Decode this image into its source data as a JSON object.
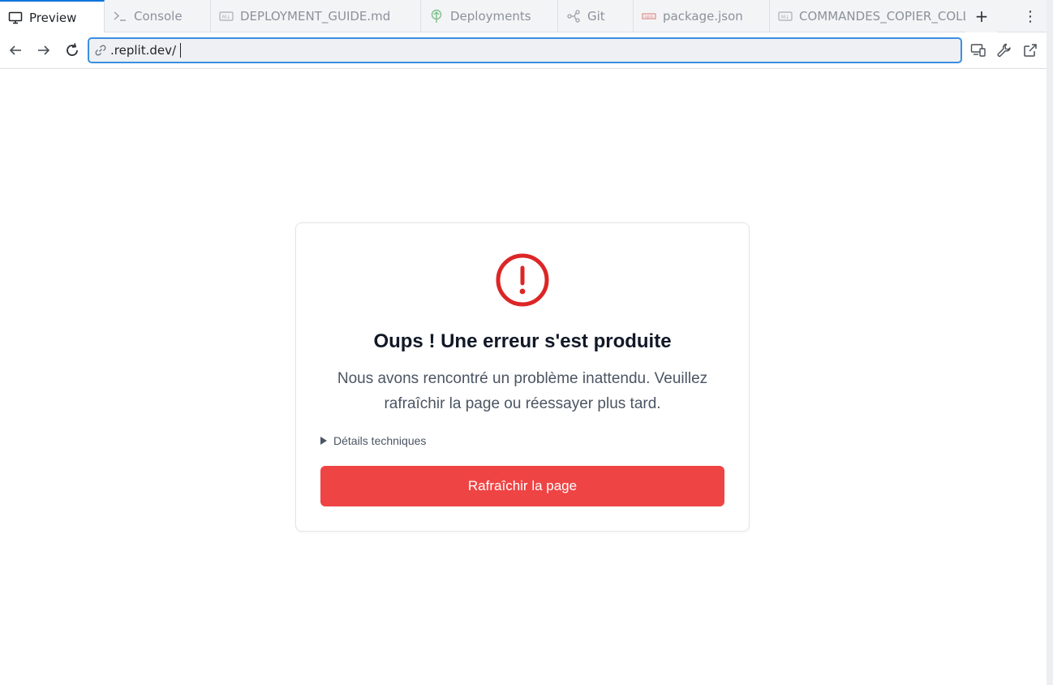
{
  "tabs": [
    {
      "label": "Preview",
      "icon": "monitor-icon",
      "active": true
    },
    {
      "label": "Console",
      "icon": "terminal-icon",
      "active": false
    },
    {
      "label": "DEPLOYMENT_GUIDE.md",
      "icon": "markdown-icon",
      "active": false
    },
    {
      "label": "Deployments",
      "icon": "deployments-icon",
      "active": false
    },
    {
      "label": "Git",
      "icon": "git-icon",
      "active": false
    },
    {
      "label": "package.json",
      "icon": "npm-icon",
      "active": false
    },
    {
      "label": "COMMANDES_COPIER_COLL",
      "icon": "markdown-icon",
      "active": false
    }
  ],
  "tabbar": {
    "add_glyph": "+",
    "menu_glyph": "⋮"
  },
  "address": {
    "url": ".replit.dev/"
  },
  "error": {
    "title": "Oups ! Une erreur s'est produite",
    "message": "Nous avons rencontré un problème inattendu. Veuillez rafraîchir la page ou réessayer plus tard.",
    "details_label": "Détails techniques",
    "button_label": "Rafraîchir la page"
  },
  "colors": {
    "accent": "#0b74de",
    "danger": "#ef4444",
    "danger_icon": "#dc2626"
  }
}
